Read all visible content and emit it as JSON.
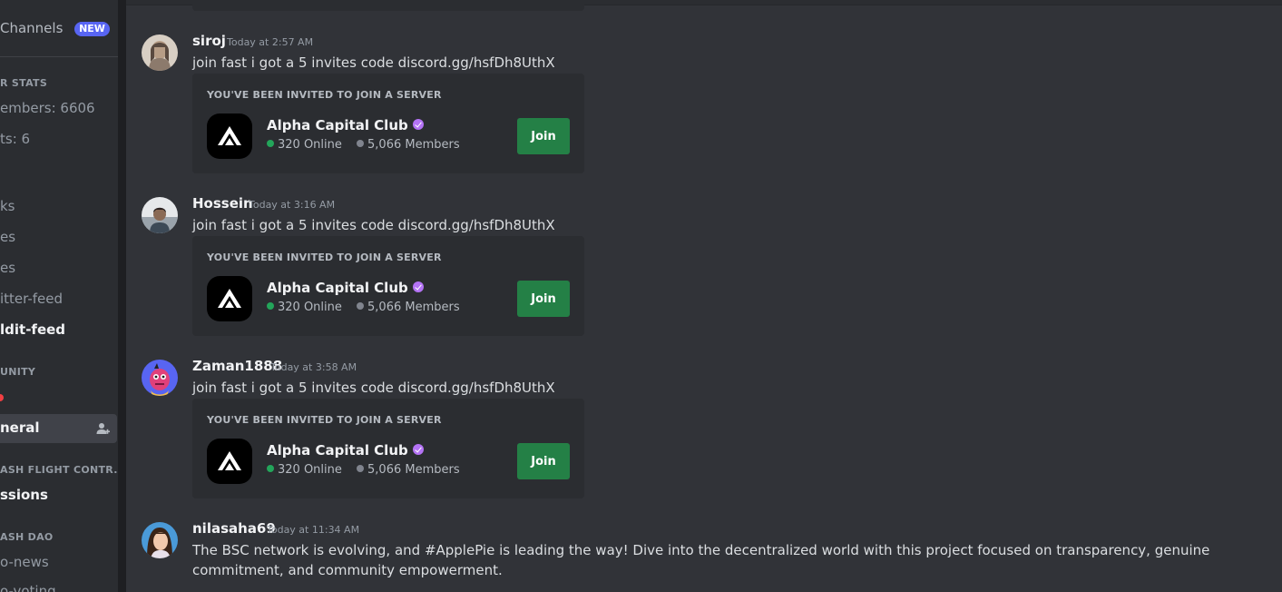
{
  "sidebar": {
    "top_label": "Channels",
    "new_badge": "NEW",
    "stats_category": "R STATS",
    "members_stat": "embers: 6606",
    "bots_stat": "ts: 6",
    "channels_a": [
      {
        "label": "ks",
        "unread": false
      },
      {
        "label": "es",
        "unread": false
      },
      {
        "label": "es",
        "unread": false
      },
      {
        "label": "itter-feed",
        "unread": false
      },
      {
        "label": "ldit-feed",
        "unread": true
      }
    ],
    "community_category": "UNITY",
    "active_channel": "neral",
    "flight_category": "ASH FLIGHT CONTR...",
    "flight_channel": "ssions",
    "dao_category": "ASH DAO",
    "dao_channels": [
      {
        "label": "o-news"
      },
      {
        "label": "o-voting"
      }
    ]
  },
  "messages": [
    {
      "username": "siroj",
      "timestamp": "Today at 2:57 AM",
      "text": "join fast i got a 5 invites code discord.gg/hsfDh8UthX",
      "invite": {
        "header": "YOU'VE BEEN INVITED TO JOIN A SERVER",
        "server_name": "Alpha Capital Club",
        "online": "320 Online",
        "members": "5,066 Members",
        "join_label": "Join"
      }
    },
    {
      "username": "Hossein",
      "timestamp": "Today at 3:16 AM",
      "text": "join fast i got a 5 invites code discord.gg/hsfDh8UthX",
      "invite": {
        "header": "YOU'VE BEEN INVITED TO JOIN A SERVER",
        "server_name": "Alpha Capital Club",
        "online": "320 Online",
        "members": "5,066 Members",
        "join_label": "Join"
      }
    },
    {
      "username": "Zaman1888",
      "timestamp": "Today at 3:58 AM",
      "text": "join fast i got a 5 invites code discord.gg/hsfDh8UthX",
      "invite": {
        "header": "YOU'VE BEEN INVITED TO JOIN A SERVER",
        "server_name": "Alpha Capital Club",
        "online": "320 Online",
        "members": "5,066 Members",
        "join_label": "Join"
      }
    },
    {
      "username": "nilasaha69",
      "timestamp": "Today at 11:34 AM",
      "text": "The BSC network is evolving, and #ApplePie is leading the way! Dive into the decentralized world with this project focused on transparency, genuine commitment, and community empowerment."
    }
  ],
  "colors": {
    "background": "#313338",
    "sidebar": "#2b2d31",
    "embed": "#2b2d31",
    "join_button": "#248046",
    "online_dot": "#23a55a",
    "new_badge": "#5865f2"
  }
}
